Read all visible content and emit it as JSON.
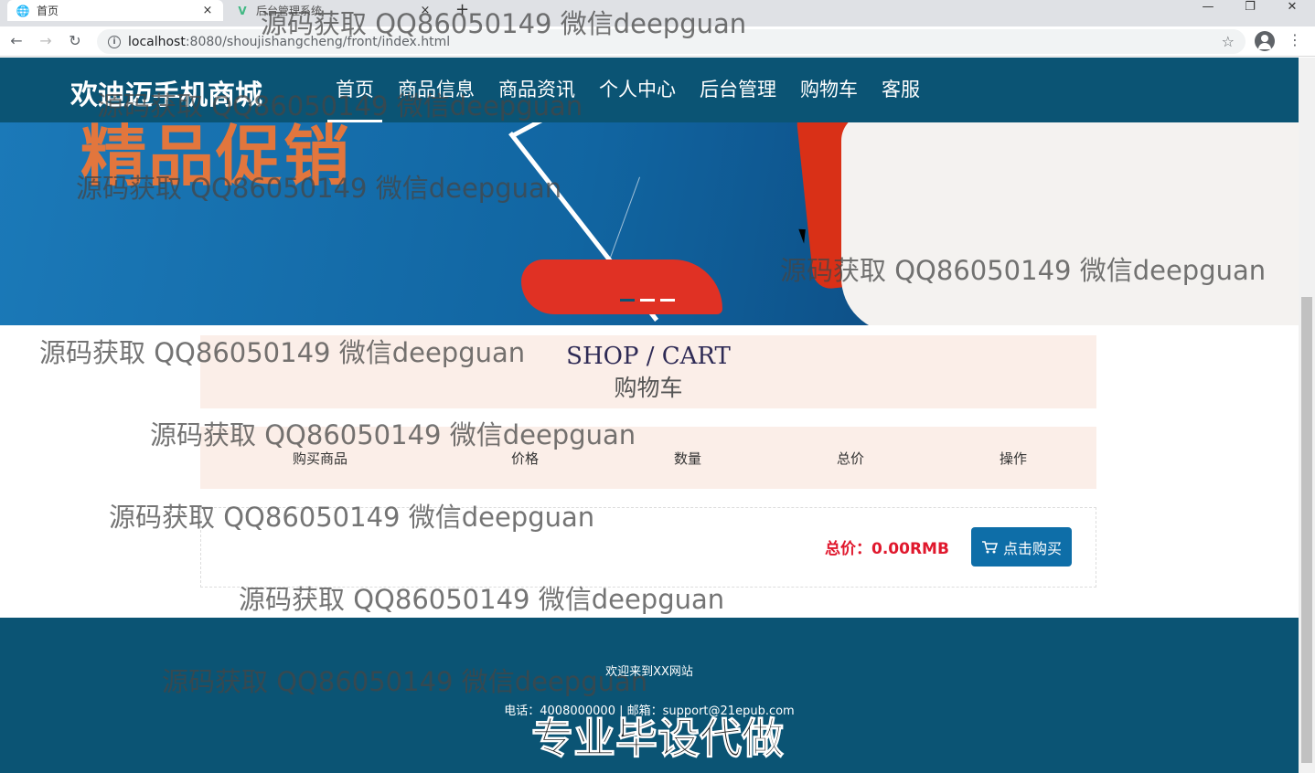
{
  "browser": {
    "tabs": [
      {
        "title": "首页",
        "icon": "globe-icon",
        "close": "×"
      },
      {
        "title": "后台管理系统",
        "icon": "vue-logo-icon",
        "close": "×"
      }
    ],
    "new_tab": "+",
    "window_controls": {
      "minimize": "—",
      "restore": "❐",
      "close": "✕"
    },
    "url_host": "localhost",
    "url_path": ":8080/shoujishangcheng/front/index.html"
  },
  "site": {
    "brand": "欢迪迈手机商城",
    "nav": [
      "首页",
      "商品信息",
      "商品资讯",
      "个人中心",
      "后台管理",
      "购物车",
      "客服"
    ],
    "nav_active_index": 0,
    "banner": {
      "promo_text": "精品促销",
      "slides": 3,
      "active_slide": 0
    },
    "cart": {
      "title_en": "SHOP / CART",
      "title_zh": "购物车",
      "columns": [
        "购买商品",
        "价格",
        "数量",
        "总价",
        "操作"
      ],
      "total_label": "总价：0.00RMB",
      "buy_button": "点击购买"
    },
    "footer": {
      "welcome": "欢迎来到XX网站",
      "contact": "电话：4008000000 | 邮箱：support@21epub.com"
    }
  },
  "overlay": {
    "watermark": "源码获取 QQ86050149 微信deepguan",
    "bottom_slogan": "专业毕设代做"
  },
  "colors": {
    "header": "#0b5474",
    "cart_bg": "#fbeee8",
    "total": "#e0182d",
    "buy_button": "#0e6ea8"
  }
}
